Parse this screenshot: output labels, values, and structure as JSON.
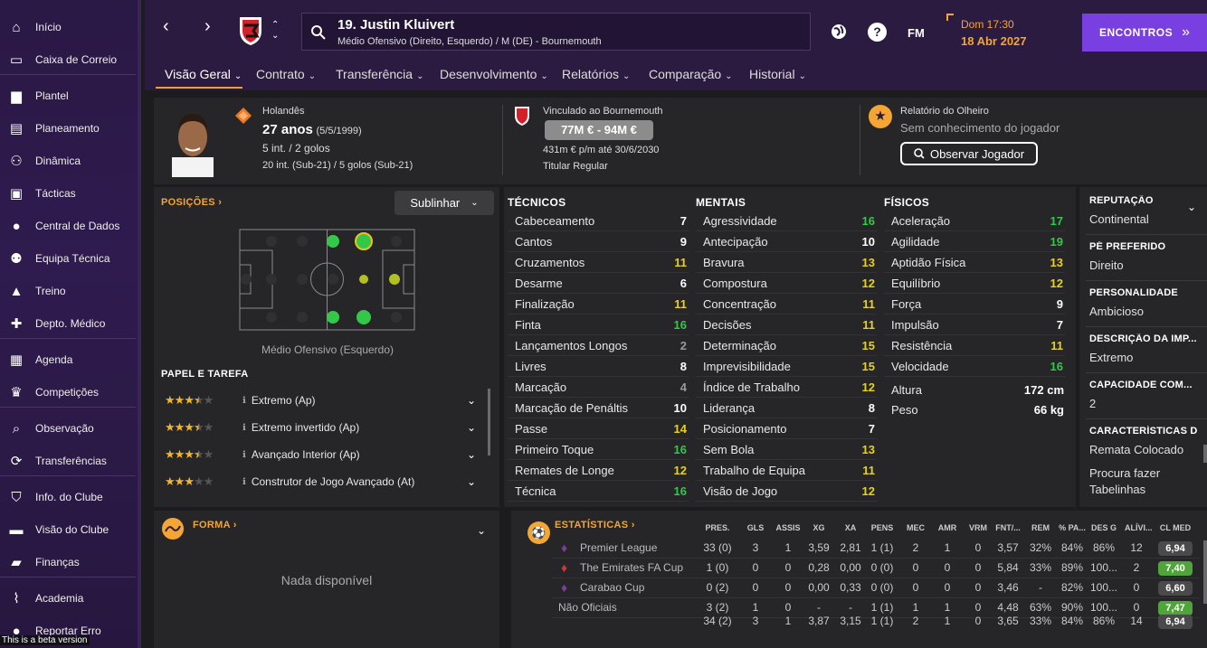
{
  "sidebar": {
    "items": [
      {
        "label": "Início",
        "icon": "home-icon"
      },
      {
        "label": "Caixa de Correio",
        "icon": "inbox-icon"
      },
      {
        "label": "Plantel",
        "icon": "shirt-icon"
      },
      {
        "label": "Planeamento",
        "icon": "clipboard-icon"
      },
      {
        "label": "Dinâmica",
        "icon": "people-dynamics-icon"
      },
      {
        "label": "Tácticas",
        "icon": "tactics-icon"
      },
      {
        "label": "Central de Dados",
        "icon": "data-hub-icon"
      },
      {
        "label": "Equipa Técnica",
        "icon": "staff-icon"
      },
      {
        "label": "Treino",
        "icon": "training-cone-icon"
      },
      {
        "label": "Depto. Médico",
        "icon": "medical-icon"
      },
      {
        "label": "Agenda",
        "icon": "calendar-icon"
      },
      {
        "label": "Competições",
        "icon": "trophy-icon"
      },
      {
        "label": "Observação",
        "icon": "scouting-icon"
      },
      {
        "label": "Transferências",
        "icon": "transfers-icon"
      },
      {
        "label": "Info. do Clube",
        "icon": "club-shield-icon"
      },
      {
        "label": "Visão do Clube",
        "icon": "briefcase-icon"
      },
      {
        "label": "Finanças",
        "icon": "money-icon"
      },
      {
        "label": "Academia",
        "icon": "academy-icon"
      },
      {
        "label": "Reportar Erro",
        "icon": "bug-report-icon"
      }
    ],
    "beta": "This is a beta version"
  },
  "header": {
    "player_title": "19. Justin Kluivert",
    "player_sub": "Médio Ofensivo (Direito, Esquerdo) / M (DE) - Bournemouth",
    "day_time": "Dom 17:30",
    "date": "18 Abr 2027",
    "fm": "FM",
    "help": "?",
    "continue": "ENCONTROS",
    "continue_icon": "»"
  },
  "tabs": [
    {
      "label": "Visão Geral"
    },
    {
      "label": "Contrato"
    },
    {
      "label": "Transferência"
    },
    {
      "label": "Desenvolvimento"
    },
    {
      "label": "Relatórios"
    },
    {
      "label": "Comparação"
    },
    {
      "label": "Historial"
    }
  ],
  "profile": {
    "nationality": "Holandês",
    "age": "27 anos",
    "dob": "(5/5/1999)",
    "caps": "5 int. / 2 golos",
    "youth_caps": "20 int. (Sub-21) / 5 golos (Sub-21)",
    "club_line": "Vinculado ao Bournemouth",
    "value": "77M € - 94M €",
    "wage": "431m € p/m até 30/6/2030",
    "status": "Titular Regular",
    "scout_title": "Relatório do Olheiro",
    "scout_sub": "Sem conhecimento do jogador",
    "scout_btn": "Observar Jogador"
  },
  "positions": {
    "title": "POSIÇÕES",
    "highlight_btn": "Sublinhar",
    "caption": "Médio Ofensivo (Esquerdo)"
  },
  "roles": {
    "title": "PAPEL E TAREFA",
    "items": [
      {
        "stars": 3.5,
        "name": "Extremo (Ap)"
      },
      {
        "stars": 3.5,
        "name": "Extremo invertido (Ap)"
      },
      {
        "stars": 3.5,
        "name": "Avançado Interior (Ap)"
      },
      {
        "stars": 3.0,
        "name": "Construtor de Jogo Avançado (At)"
      }
    ]
  },
  "attributes": {
    "technical": {
      "title": "TÉCNICOS",
      "items": [
        [
          "Cabeceamento",
          "7"
        ],
        [
          "Cantos",
          "9"
        ],
        [
          "Cruzamentos",
          "11"
        ],
        [
          "Desarme",
          "6"
        ],
        [
          "Finalização",
          "11"
        ],
        [
          "Finta",
          "16"
        ],
        [
          "Lançamentos Longos",
          "2"
        ],
        [
          "Livres",
          "8"
        ],
        [
          "Marcação",
          "4"
        ],
        [
          "Marcação de Penáltis",
          "10"
        ],
        [
          "Passe",
          "14"
        ],
        [
          "Primeiro Toque",
          "16"
        ],
        [
          "Remates de Longe",
          "12"
        ],
        [
          "Técnica",
          "16"
        ]
      ]
    },
    "mental": {
      "title": "MENTAIS",
      "items": [
        [
          "Agressividade",
          "16"
        ],
        [
          "Antecipação",
          "10"
        ],
        [
          "Bravura",
          "13"
        ],
        [
          "Compostura",
          "12"
        ],
        [
          "Concentração",
          "11"
        ],
        [
          "Decisões",
          "11"
        ],
        [
          "Determinação",
          "15"
        ],
        [
          "Imprevisibilidade",
          "15"
        ],
        [
          "Índice de Trabalho",
          "12"
        ],
        [
          "Liderança",
          "8"
        ],
        [
          "Posicionamento",
          "7"
        ],
        [
          "Sem Bola",
          "13"
        ],
        [
          "Trabalho de Equipa",
          "11"
        ],
        [
          "Visão de Jogo",
          "12"
        ]
      ]
    },
    "physical": {
      "title": "FÍSICOS",
      "items": [
        [
          "Aceleração",
          "17"
        ],
        [
          "Agilidade",
          "19"
        ],
        [
          "Aptidão Física",
          "13"
        ],
        [
          "Equilíbrio",
          "12"
        ],
        [
          "Força",
          "9"
        ],
        [
          "Impulsão",
          "7"
        ],
        [
          "Resistência",
          "11"
        ],
        [
          "Velocidade",
          "16"
        ]
      ],
      "height_label": "Altura",
      "height": "172 cm",
      "weight_label": "Peso",
      "weight": "66 kg"
    }
  },
  "info": [
    {
      "title": "REPUTAÇÃO",
      "value": "Continental"
    },
    {
      "title": "PÉ PREFERIDO",
      "value": "Direito"
    },
    {
      "title": "PERSONALIDADE",
      "value": "Ambicioso"
    },
    {
      "title": "DESCRIÇÃO DA IMP...",
      "value": "Extremo"
    },
    {
      "title": "CAPACIDADE COM...",
      "value": "2"
    },
    {
      "title": "CARACTERÍSTICAS D",
      "value": "Remata Colocado"
    }
  ],
  "traits_extra": [
    "Procura fazer",
    "Tabelinhas"
  ],
  "form": {
    "title": "FORMA",
    "empty": "Nada disponível"
  },
  "stats": {
    "title": "ESTATÍSTICAS",
    "headers": [
      "PRES.",
      "GLS",
      "ASSIS",
      "XG",
      "XA",
      "PENS",
      "MEC",
      "AMR",
      "VRM",
      "FNT/...",
      "REM",
      "% PA...",
      "DES G",
      "ALÍVI...",
      "CL MED"
    ],
    "rows": [
      {
        "comp": "Premier League",
        "vals": [
          "33 (0)",
          "3",
          "1",
          "3,59",
          "2,81",
          "1 (1)",
          "2",
          "1",
          "0",
          "3,57",
          "32%",
          "84%",
          "86%",
          "12",
          "6,94"
        ],
        "rating_color": "#4a4a4a"
      },
      {
        "comp": "The Emirates FA Cup",
        "vals": [
          "1 (0)",
          "0",
          "0",
          "0,28",
          "0,00",
          "0 (0)",
          "0",
          "0",
          "0",
          "5,84",
          "33%",
          "89%",
          "100...",
          "2",
          "7,40"
        ],
        "rating_color": "#4fa43a"
      },
      {
        "comp": "Carabao Cup",
        "vals": [
          "0 (2)",
          "0",
          "0",
          "0,00",
          "0,33",
          "0 (0)",
          "0",
          "0",
          "0",
          "3,46",
          "-",
          "82%",
          "100...",
          "0",
          "6,60"
        ],
        "rating_color": "#4a4a4a"
      },
      {
        "comp": "Não Oficiais",
        "vals": [
          "3 (2)",
          "1",
          "0",
          "-",
          "-",
          "1 (1)",
          "1",
          "1",
          "0",
          "4,48",
          "63%",
          "90%",
          "100...",
          "0",
          "7,47"
        ],
        "rating_color": "#4fa43a"
      },
      {
        "comp": "",
        "vals": [
          "34 (2)",
          "3",
          "1",
          "3,87",
          "3,15",
          "1 (1)",
          "2",
          "1",
          "0",
          "3,65",
          "33%",
          "84%",
          "86%",
          "14",
          "6,94"
        ],
        "rating_color": "#4a4a4a"
      }
    ]
  },
  "colors": {
    "accent": "#f4a533",
    "primary": "#7a3fe0",
    "green": "#34c84a",
    "yellow": "#e8d020"
  }
}
